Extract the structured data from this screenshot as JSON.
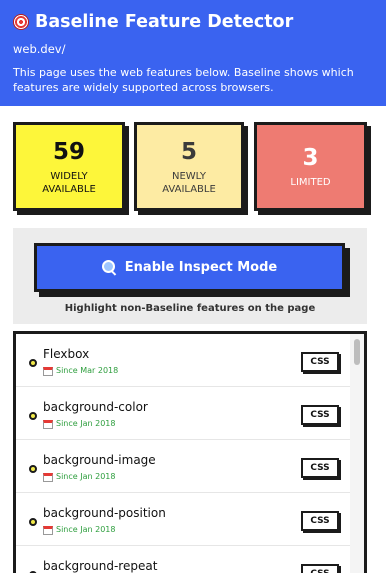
{
  "header": {
    "icon": "target-icon",
    "title": "Baseline Feature Detector",
    "url": "web.dev/",
    "description": "This page uses the web features below. Baseline shows which features are widely supported across browsers."
  },
  "stats": {
    "widely": {
      "count": "59",
      "label": "WIDELY\nAVAILABLE",
      "color": "#fdf63a"
    },
    "newly": {
      "count": "5",
      "label": "NEWLY\nAVAILABLE",
      "color": "#fdeba3"
    },
    "limited": {
      "count": "3",
      "label": "LIMITED",
      "color": "#ee7b72"
    }
  },
  "inspect": {
    "button_label": "Enable Inspect Mode",
    "button_icon": "magnifier-icon",
    "hint": "Highlight non-Baseline features on the page"
  },
  "features": [
    {
      "name": "Flexbox",
      "since": "Since Mar 2018",
      "badge": "CSS"
    },
    {
      "name": "background-color",
      "since": "Since Jan 2018",
      "badge": "CSS"
    },
    {
      "name": "background-image",
      "since": "Since Jan 2018",
      "badge": "CSS"
    },
    {
      "name": "background-position",
      "since": "Since Jan 2018",
      "badge": "CSS"
    },
    {
      "name": "background-repeat",
      "since": "",
      "badge": "CSS"
    }
  ],
  "colors": {
    "brand": "#3a63f0",
    "widely": "#fdf63a",
    "newly": "#fdeba3",
    "limited": "#ee7b72",
    "since_text": "#2e9e3e"
  }
}
